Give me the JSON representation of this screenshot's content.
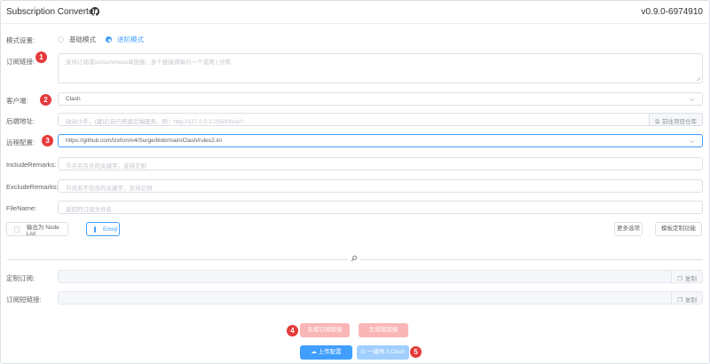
{
  "header": {
    "title": "Subscription Converter",
    "version": "v0.9.0-6974910"
  },
  "mode": {
    "label": "模式设置:",
    "options": [
      "基础模式",
      "进阶模式"
    ],
    "selected": "进阶模式"
  },
  "subscription": {
    "label": "订阅链接:",
    "placeholder": "支持订阅或ss/ssr/vmess单链接。多个链接请每行一个或用 | 分隔"
  },
  "client": {
    "label": "客户端:",
    "value": "Clash"
  },
  "backend": {
    "label": "后端地址:",
    "placeholder": "动动小手，(建议)自行搭建后端服务。例：http://127.0.0.1:25500/sub?",
    "button": "前往项目仓库"
  },
  "remote_config": {
    "label": "远程配置:",
    "value": "https://github.com/lzxfcmm4/Surge/blob/main/Clash/rules2.ini"
  },
  "include": {
    "label": "IncludeRemarks:",
    "placeholder": "节点名包含的关键字，支持正则"
  },
  "exclude": {
    "label": "ExcludeRemarks:",
    "placeholder": "节点名不包含的关键字，支持正则"
  },
  "filename": {
    "label": "FileName:",
    "placeholder": "返回的订阅文件名"
  },
  "options": {
    "node_list": "输出为 Node List",
    "emoji": "Emoji",
    "more": "更多选项",
    "custom": "模板定制功能"
  },
  "custom_sub": {
    "label": "定制订阅:",
    "copy": "复制"
  },
  "short_link": {
    "label": "订阅短链接:",
    "copy": "复制"
  },
  "actions": {
    "generate_sub": "生成订阅链接",
    "generate_short": "生成短链接",
    "upload": "上传配置",
    "import_clash": "一键导入Clash"
  },
  "badges": [
    "1",
    "2",
    "3",
    "4",
    "5"
  ],
  "colors": {
    "primary": "#409eff",
    "danger_light": "#fab6b6",
    "badge": "#e5393a"
  }
}
